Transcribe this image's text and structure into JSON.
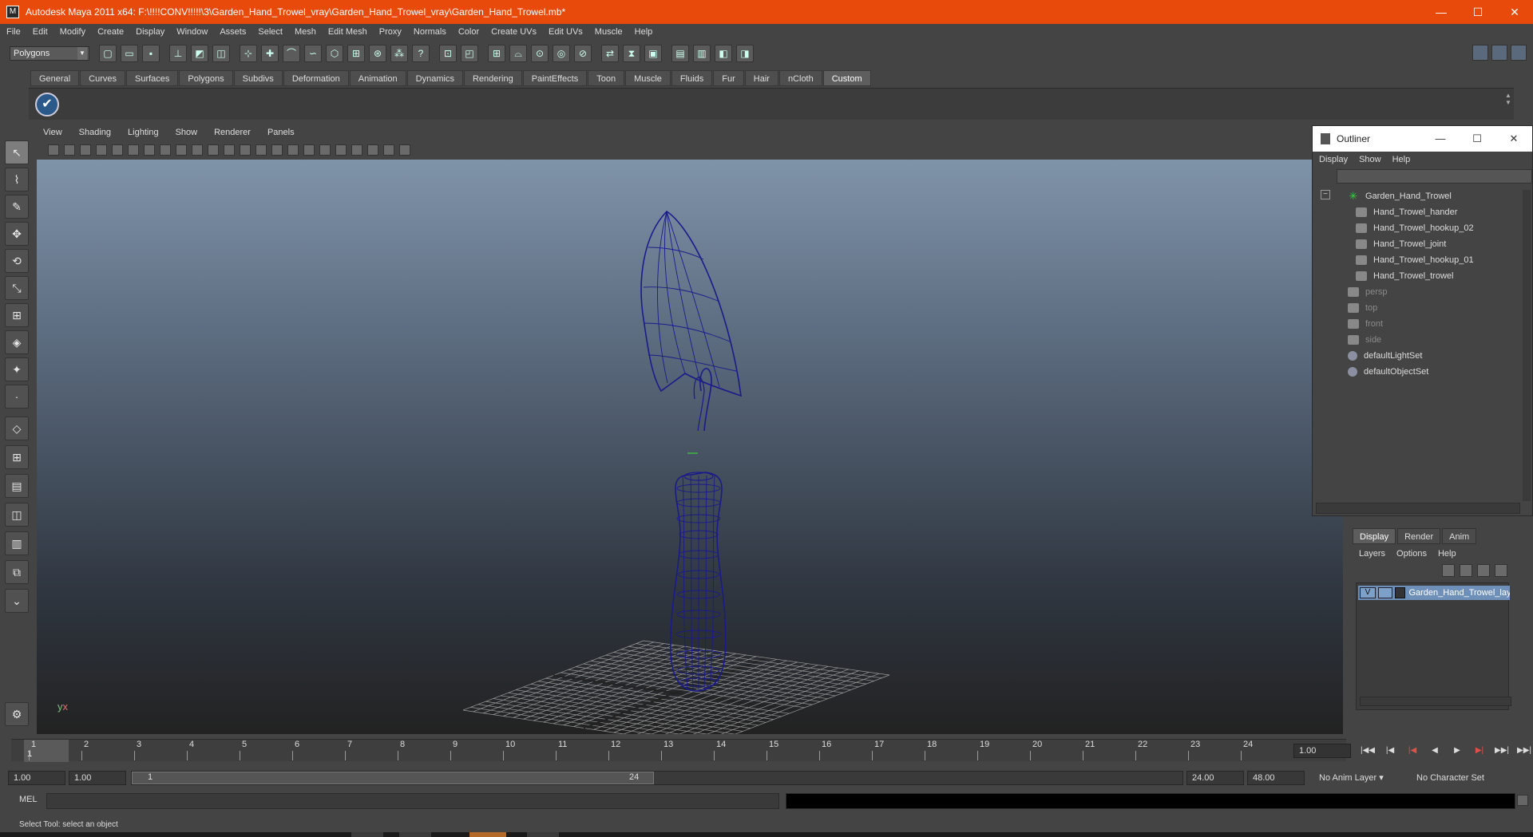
{
  "window": {
    "title": "Autodesk Maya 2011 x64: F:\\!!!!CONV!!!!!\\3\\Garden_Hand_Trowel_vray\\Garden_Hand_Trowel_vray\\Garden_Hand_Trowel.mb*",
    "icon": "maya-app-icon",
    "minimize": "—",
    "maximize": "☐",
    "close": "✕"
  },
  "menubar": [
    "File",
    "Edit",
    "Modify",
    "Create",
    "Display",
    "Window",
    "Assets",
    "Select",
    "Mesh",
    "Edit Mesh",
    "Proxy",
    "Normals",
    "Color",
    "Create UVs",
    "Edit UVs",
    "Muscle",
    "Help"
  ],
  "status_line": {
    "mode": "Polygons"
  },
  "shelf": {
    "tabs": [
      "General",
      "Curves",
      "Surfaces",
      "Polygons",
      "Subdivs",
      "Deformation",
      "Animation",
      "Dynamics",
      "Rendering",
      "PaintEffects",
      "Toon",
      "Muscle",
      "Fluids",
      "Fur",
      "Hair",
      "nCloth",
      "Custom"
    ],
    "active_tab": "Custom",
    "item_icon": "checkmark-icon"
  },
  "panel_menu": [
    "View",
    "Shading",
    "Lighting",
    "Show",
    "Renderer",
    "Panels"
  ],
  "viewport": {
    "axis_y": "y",
    "axis_x": "x",
    "wire_color": "#1a1a8a",
    "grid_color": "#9a9a9a"
  },
  "outliner": {
    "title": "Outliner",
    "menu": [
      "Display",
      "Show",
      "Help"
    ],
    "collapse": "−",
    "items": [
      {
        "label": "Garden_Hand_Trowel",
        "type": "group",
        "dim": false
      },
      {
        "label": "Hand_Trowel_hander",
        "type": "mesh",
        "dim": false
      },
      {
        "label": "Hand_Trowel_hookup_02",
        "type": "mesh",
        "dim": false
      },
      {
        "label": "Hand_Trowel_joint",
        "type": "mesh",
        "dim": false
      },
      {
        "label": "Hand_Trowel_hookup_01",
        "type": "mesh",
        "dim": false
      },
      {
        "label": "Hand_Trowel_trowel",
        "type": "mesh",
        "dim": false
      },
      {
        "label": "persp",
        "type": "camera",
        "dim": true
      },
      {
        "label": "top",
        "type": "camera",
        "dim": true
      },
      {
        "label": "front",
        "type": "camera",
        "dim": true
      },
      {
        "label": "side",
        "type": "camera",
        "dim": true
      },
      {
        "label": "defaultLightSet",
        "type": "set",
        "dim": false
      },
      {
        "label": "defaultObjectSet",
        "type": "set",
        "dim": false
      }
    ]
  },
  "layer_editor": {
    "tabs": [
      "Display",
      "Render",
      "Anim"
    ],
    "active_tab": "Display",
    "menu": [
      "Layers",
      "Options",
      "Help"
    ],
    "layer": {
      "visible": "V",
      "name": "Garden_Hand_Trowel_lay"
    }
  },
  "time_slider": {
    "ticks": [
      "1",
      "2",
      "3",
      "4",
      "5",
      "6",
      "7",
      "8",
      "9",
      "10",
      "11",
      "12",
      "13",
      "14",
      "15",
      "16",
      "17",
      "18",
      "19",
      "20",
      "21",
      "22",
      "23",
      "24"
    ],
    "current_frame": "1",
    "current_field": "1.00"
  },
  "playback": [
    "|◀◀",
    "|◀",
    "|◀",
    "◀",
    "▶",
    "▶|",
    "▶▶|",
    "▶▶|"
  ],
  "range_slider": {
    "start_time": "1.00",
    "playback_start": "1.00",
    "range_start_label": "1",
    "range_end_label": "24",
    "playback_end": "24.00",
    "end_time": "48.00",
    "anim_layer": "No Anim Layer",
    "character_set": "No Character Set"
  },
  "command_line": {
    "label": "MEL"
  },
  "help_line": "Select Tool: select an object",
  "toolbox": [
    {
      "name": "select-tool-icon",
      "glyph": "↖"
    },
    {
      "name": "lasso-tool-icon",
      "glyph": "⌇"
    },
    {
      "name": "paint-select-tool-icon",
      "glyph": "✎"
    },
    {
      "name": "move-tool-icon",
      "glyph": "✥"
    },
    {
      "name": "rotate-tool-icon",
      "glyph": "⟲"
    },
    {
      "name": "scale-tool-icon",
      "glyph": "⤡"
    },
    {
      "name": "universal-manipulator-icon",
      "glyph": "⊞"
    },
    {
      "name": "soft-mod-tool-icon",
      "glyph": "◈"
    },
    {
      "name": "show-manipulator-icon",
      "glyph": "✦"
    },
    {
      "name": "last-tool-icon",
      "glyph": "·"
    },
    {
      "name": "single-perspective-layout-icon",
      "glyph": "◇"
    },
    {
      "name": "four-view-layout-icon",
      "glyph": "⊞"
    },
    {
      "name": "persp-outliner-layout-icon",
      "glyph": "▤"
    },
    {
      "name": "persp-graph-layout-icon",
      "glyph": "◫"
    },
    {
      "name": "hypershade-layout-icon",
      "glyph": "▥"
    },
    {
      "name": "persp-hypergraph-layout-icon",
      "glyph": "⧉"
    },
    {
      "name": "layout-options-icon",
      "glyph": "⌄"
    }
  ]
}
